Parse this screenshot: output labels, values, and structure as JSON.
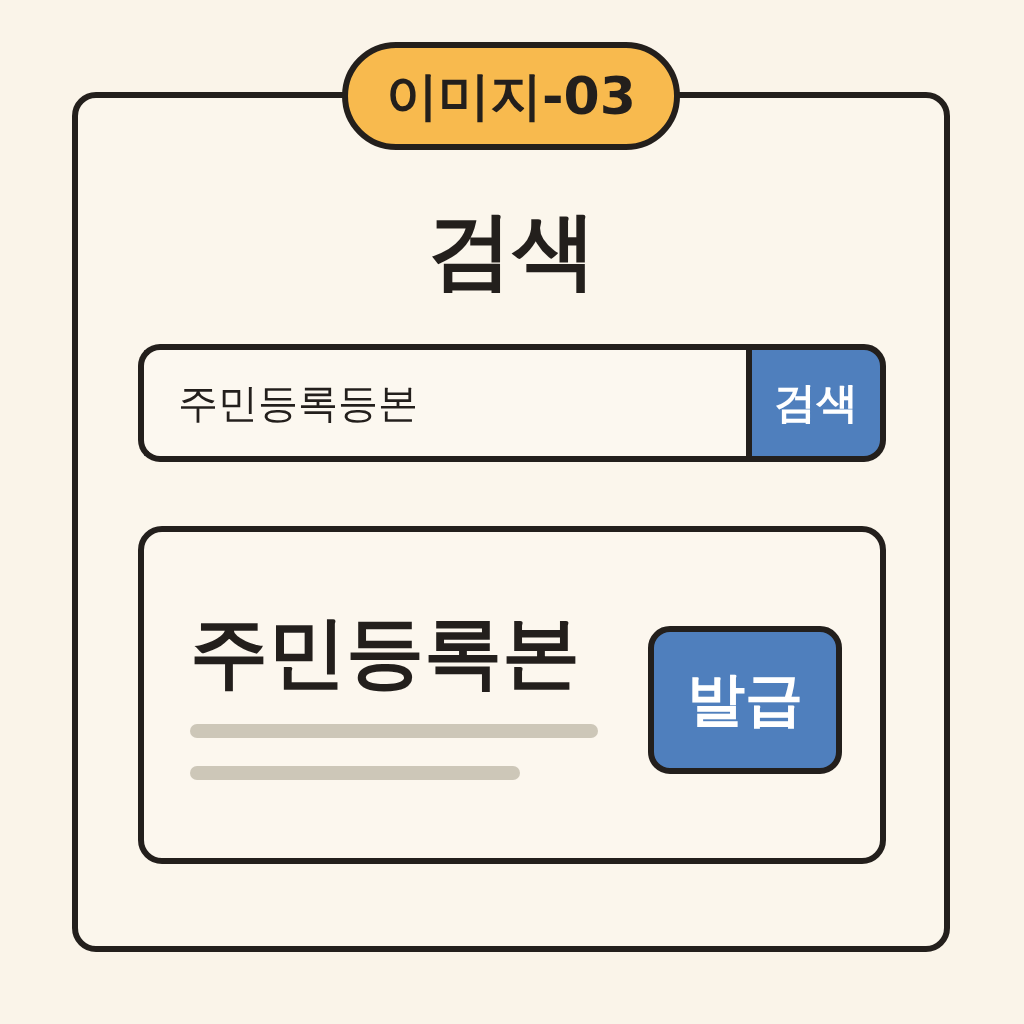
{
  "badge": {
    "label": "이미지-03"
  },
  "title": "검색",
  "search": {
    "value": "주민등록등본",
    "button": "검색"
  },
  "result": {
    "title": "주민등록본",
    "button": "발급"
  }
}
